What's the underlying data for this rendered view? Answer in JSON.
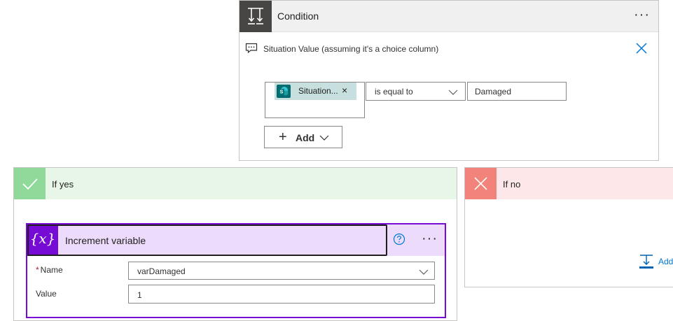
{
  "condition": {
    "title": "Condition",
    "more": "···",
    "comment": "Situation Value (assuming it's a choice column)",
    "token_label": "Situation...",
    "token_remove": "×",
    "operator": "is equal to",
    "value": "Damaged",
    "add_label": "Add",
    "add_plus": "+"
  },
  "if_yes": {
    "title": "If yes",
    "action": {
      "title": "Increment variable",
      "icon_text": "{x}",
      "more": "···",
      "name_required": "*",
      "name_label": "Name",
      "name_value": "varDamaged",
      "value_label": "Value",
      "value_value": "1"
    }
  },
  "if_no": {
    "title": "If no",
    "add_label": "Add"
  },
  "icons": {
    "condition": "condition-icon",
    "comment": "comment-icon",
    "close": "close-icon",
    "check": "check-icon",
    "x": "x-icon",
    "help": "help-icon",
    "chevron": "chevron-down-icon",
    "sharepoint": "sharepoint-icon",
    "add_action": "add-action-icon"
  },
  "colors": {
    "condition_header": "#f0f0f0",
    "condition_icon_bg": "#484644",
    "yes_header": "#e7f6e7",
    "yes_icon_bg": "#8fd99a",
    "no_header": "#fde7e9",
    "no_icon_bg": "#f1837a",
    "variable_accent": "#770bd6",
    "variable_header": "#ecdbfa",
    "link_blue": "#0078d4"
  }
}
